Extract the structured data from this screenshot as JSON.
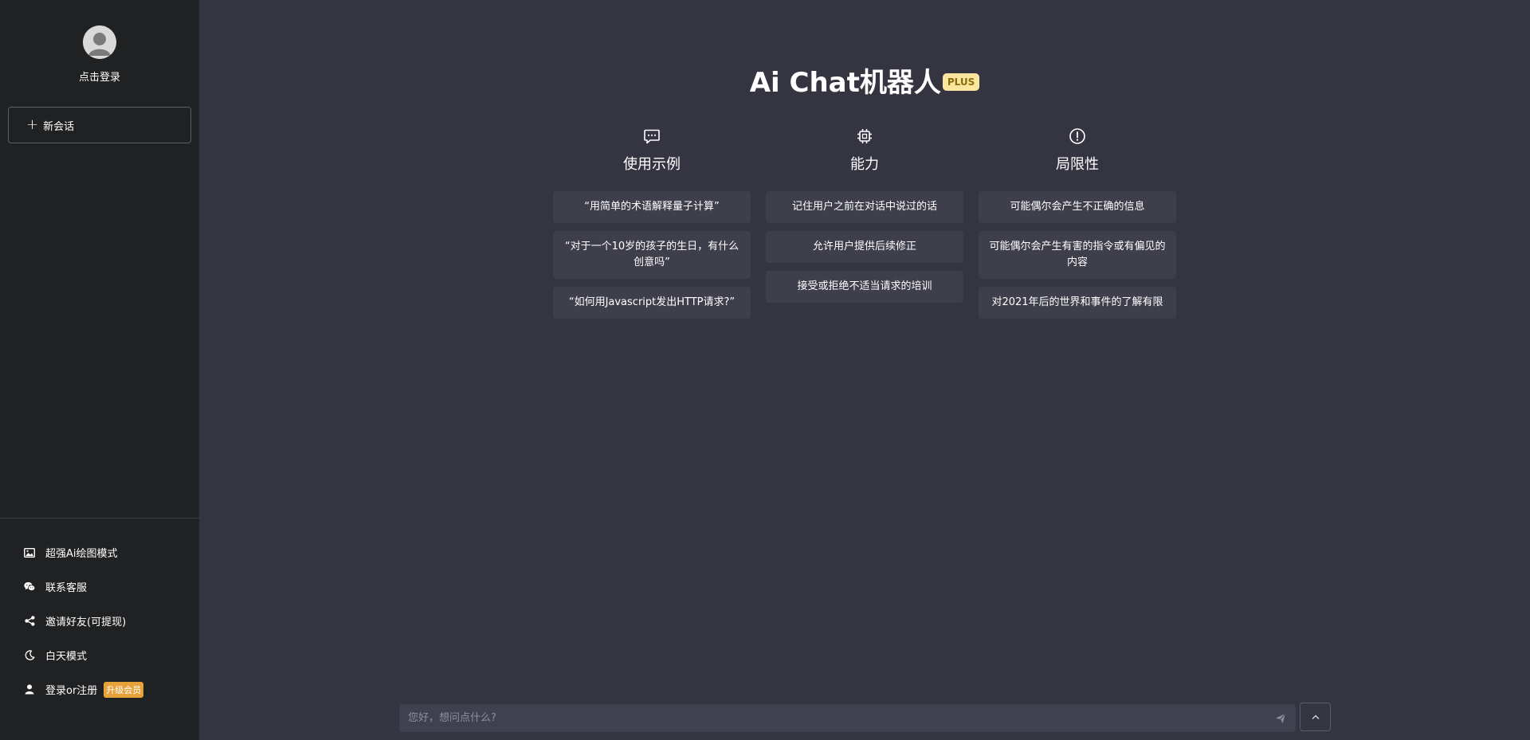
{
  "sidebar": {
    "login_label": "点击登录",
    "new_chat_label": "新会话",
    "menu": [
      {
        "label": "超强Ai绘图模式",
        "icon": "image-icon"
      },
      {
        "label": "联系客服",
        "icon": "wechat-icon"
      },
      {
        "label": "邀请好友(可提现)",
        "icon": "share-icon"
      },
      {
        "label": "白天模式",
        "icon": "moon-icon"
      },
      {
        "label": "登录or注册",
        "icon": "user-icon",
        "badge": "升级会员"
      }
    ]
  },
  "main": {
    "title": "Ai Chat机器人",
    "title_badge": "PLUS",
    "columns": [
      {
        "icon": "chat-bubble-icon",
        "title": "使用示例",
        "cards": [
          "“用简单的术语解释量子计算”",
          "“对于一个10岁的孩子的生日，有什么创意吗”",
          "“如何用Javascript发出HTTP请求?”"
        ]
      },
      {
        "icon": "cpu-icon",
        "title": "能力",
        "cards": [
          "记住用户之前在对话中说过的话",
          "允许用户提供后续修正",
          "接受或拒绝不适当请求的培训"
        ]
      },
      {
        "icon": "warning-circle-icon",
        "title": "局限性",
        "cards": [
          "可能偶尔会产生不正确的信息",
          "可能偶尔会产生有害的指令或有偏见的内容",
          "对2021年后的世界和事件的了解有限"
        ]
      }
    ]
  },
  "input": {
    "placeholder": "您好，想问点什么?",
    "value": ""
  },
  "colors": {
    "sidebar_bg": "#202123",
    "main_bg": "#343541",
    "card_bg": "#3e3f4b",
    "plus_badge_bg": "#fae69e",
    "vip_badge_bg": "#e7a23a"
  }
}
